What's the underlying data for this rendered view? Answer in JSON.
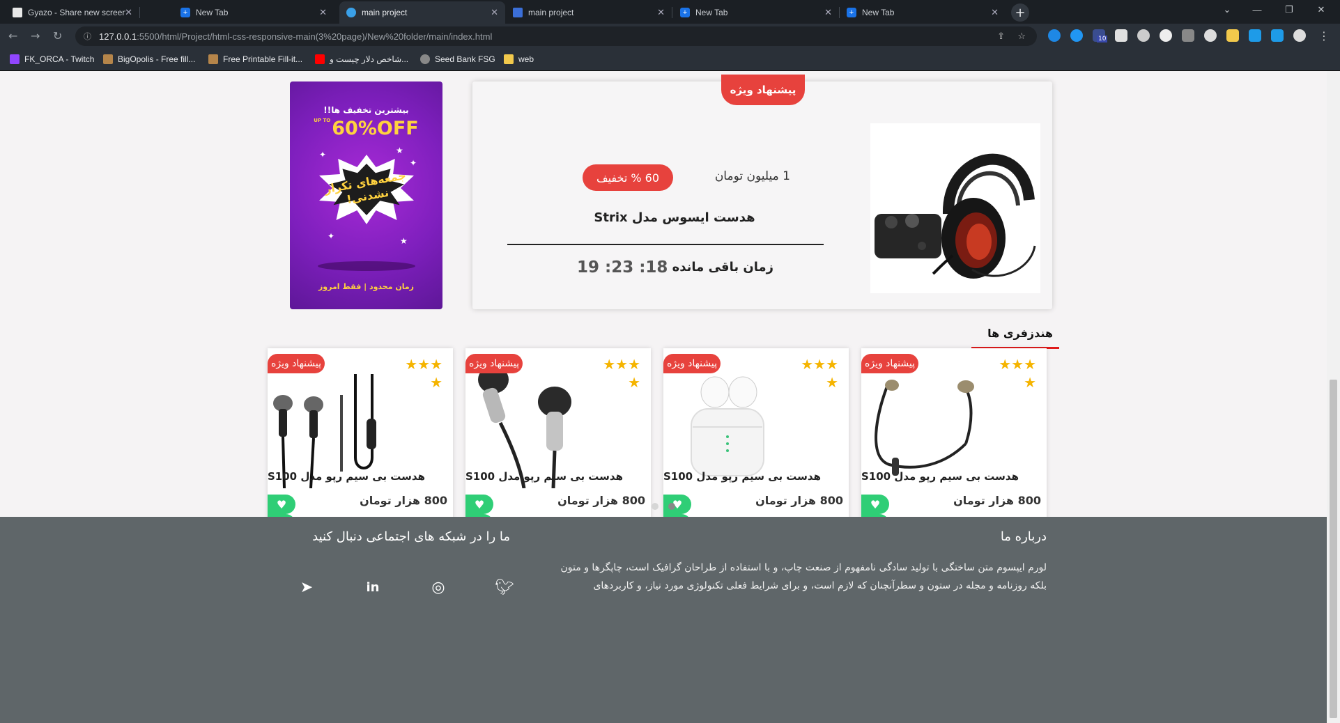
{
  "browser": {
    "tabs": [
      {
        "title": "Gyazo - Share new screenshots.",
        "favicon": "gyazo-icon",
        "active": false
      },
      {
        "title": "New Tab",
        "favicon": "new-tab-icon",
        "active": false
      },
      {
        "title": "main project",
        "favicon": "globe-icon",
        "active": true
      },
      {
        "title": "main project",
        "favicon": "live-server-icon",
        "active": false
      },
      {
        "title": "New Tab",
        "favicon": "new-tab-icon",
        "active": false
      },
      {
        "title": "New Tab",
        "favicon": "new-tab-icon",
        "active": false
      }
    ],
    "url_host": "127.0.0.1",
    "url_path": ":5500/html/Project/html-css-responsive-main(3%20page)/New%20folder/main/index.html",
    "bookmarks": [
      {
        "label": "FK_ORCA - Twitch",
        "icon": "twitch-icon",
        "color": "#9146ff"
      },
      {
        "label": "BigOpolis - Free fill...",
        "icon": "bigopolis-icon",
        "color": "#b5854a"
      },
      {
        "label": "Free Printable Fill-it...",
        "icon": "printable-icon",
        "color": "#b5854a"
      },
      {
        "label": "شاخص دلار چیست و...",
        "icon": "youtube-icon",
        "color": "#ff0000"
      },
      {
        "label": "Seed Bank FSG",
        "icon": "seed-bank-icon",
        "color": "#888888"
      },
      {
        "label": "web",
        "icon": "folder-icon",
        "color": "#f2c94c"
      }
    ],
    "extension_badge": "10"
  },
  "promo_banner": {
    "top_text": "بیشترین تخفیف ها!!",
    "off_text": "60%OFF",
    "up_to": "UP TO",
    "center_text": "جمعه‌های تکرار نشدنی!",
    "bottom_text": "زمان محدود | فقط امروز"
  },
  "special_offer": {
    "ribbon": "پیشنهاد ویژه",
    "price": "1 میلیون تومان",
    "discount": "60 % تخفیف",
    "product_name": "هدست ایسوس مدل Strix",
    "remaining_label": "زمان باقی مانده",
    "timer": "19 :23 :18",
    "image_icon": "gaming-headset-image"
  },
  "section": {
    "title": "هندزفری ها"
  },
  "products": [
    {
      "badge": "پیشنهاد ویژه",
      "title": "هدست بی سیم رپو مدل S100",
      "price": "800 هزار تومان",
      "stars": 4,
      "image_icon": "neckband-earphone-image"
    },
    {
      "badge": "پیشنهاد ویژه",
      "title": "هدست بی سیم رپو مدل S100",
      "price": "800 هزار تومان",
      "stars": 4,
      "image_icon": "wireless-earbuds-case-image"
    },
    {
      "badge": "پیشنهاد ویژه",
      "title": "هدست بی سیم رپو مدل S100",
      "price": "800 هزار تومان",
      "stars": 4,
      "image_icon": "silver-earphone-image"
    },
    {
      "badge": "پیشنهاد ویژه",
      "title": "هدست بی سیم رپو مدل S100",
      "price": "800 هزار تومان",
      "stars": 4,
      "image_icon": "black-earphones-image"
    }
  ],
  "carousel": {
    "dots": 2,
    "active_dot": 1
  },
  "footer": {
    "about_title": "درباره ما",
    "social_title": "ما را در شبکه های اجتماعی دنبال کنید",
    "about_text": "لورم ایپسوم متن ساختگی با تولید سادگی نامفهوم از صنعت چاپ، و با استفاده از طراحان گرافیک است، چاپگرها و متون بلکه روزنامه و مجله در ستون و سطرآنچنان که لازم است، و برای شرایط فعلی تکنولوژی مورد نیاز، و کاربردهای",
    "social_icons": [
      "twitter-icon",
      "instagram-icon",
      "linkedin-icon",
      "telegram-icon"
    ]
  },
  "colors": {
    "accent_red": "#e7423d",
    "accent_green": "#2fce76",
    "star_yellow": "#f5b400",
    "footer_bg": "#5f6669"
  }
}
